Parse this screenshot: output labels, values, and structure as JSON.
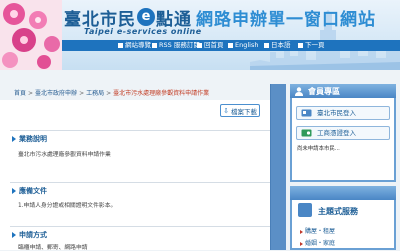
{
  "header": {
    "title_part1": "臺北市民",
    "e_badge": "e",
    "title_part2": "點通",
    "title_part3": "網路申辦單一窗口網站",
    "subtitle": "Taipei e-services online",
    "nav": [
      {
        "label": "網站導覽",
        "icon": "square-bullet"
      },
      {
        "label": "RSS 服務訂閱",
        "icon": "square-bullet"
      },
      {
        "label": "回首頁",
        "icon": "square-bullet"
      },
      {
        "label": "English",
        "icon": "square-bullet"
      },
      {
        "label": "日本語",
        "icon": "square-bullet"
      },
      {
        "label": "下一頁",
        "icon": "square-bullet"
      }
    ]
  },
  "breadcrumb": {
    "items": [
      "首頁",
      "臺北市政府申辦",
      "工務局",
      "臺北市污水處理廠參觀資料申請作業"
    ],
    "separator": ">"
  },
  "main": {
    "download_label": "檔案下載",
    "download_icon": "download-icon",
    "sections": [
      {
        "heading": "業務說明",
        "text": "臺北市污水處理廠參觀資料申請作業"
      },
      {
        "heading": "應備文件",
        "text": "1.申請人身分證或相關證明文件影本。"
      },
      {
        "heading": "申請方式",
        "text": "臨櫃申請、郵寄、網路申請"
      }
    ]
  },
  "sidebar": {
    "member_title": "會員專區",
    "member_icon": "person-icon",
    "logins": [
      {
        "label": "臺北市民登入",
        "icon": "id-card-icon"
      },
      {
        "label": "工商憑證登入",
        "icon": "certificate-icon"
      }
    ],
    "member_note": "尚未申請本市民...",
    "topic_title": "主題式服務",
    "topic_icon": "topic-icon",
    "topics": [
      "購屋・租屋",
      "婚姻・家庭"
    ]
  },
  "colors": {
    "brand_blue": "#1e73be",
    "dark_blue": "#1d5e96",
    "light_blue": "#2e8dd3",
    "breadcrumb_current": "#c23b22"
  }
}
